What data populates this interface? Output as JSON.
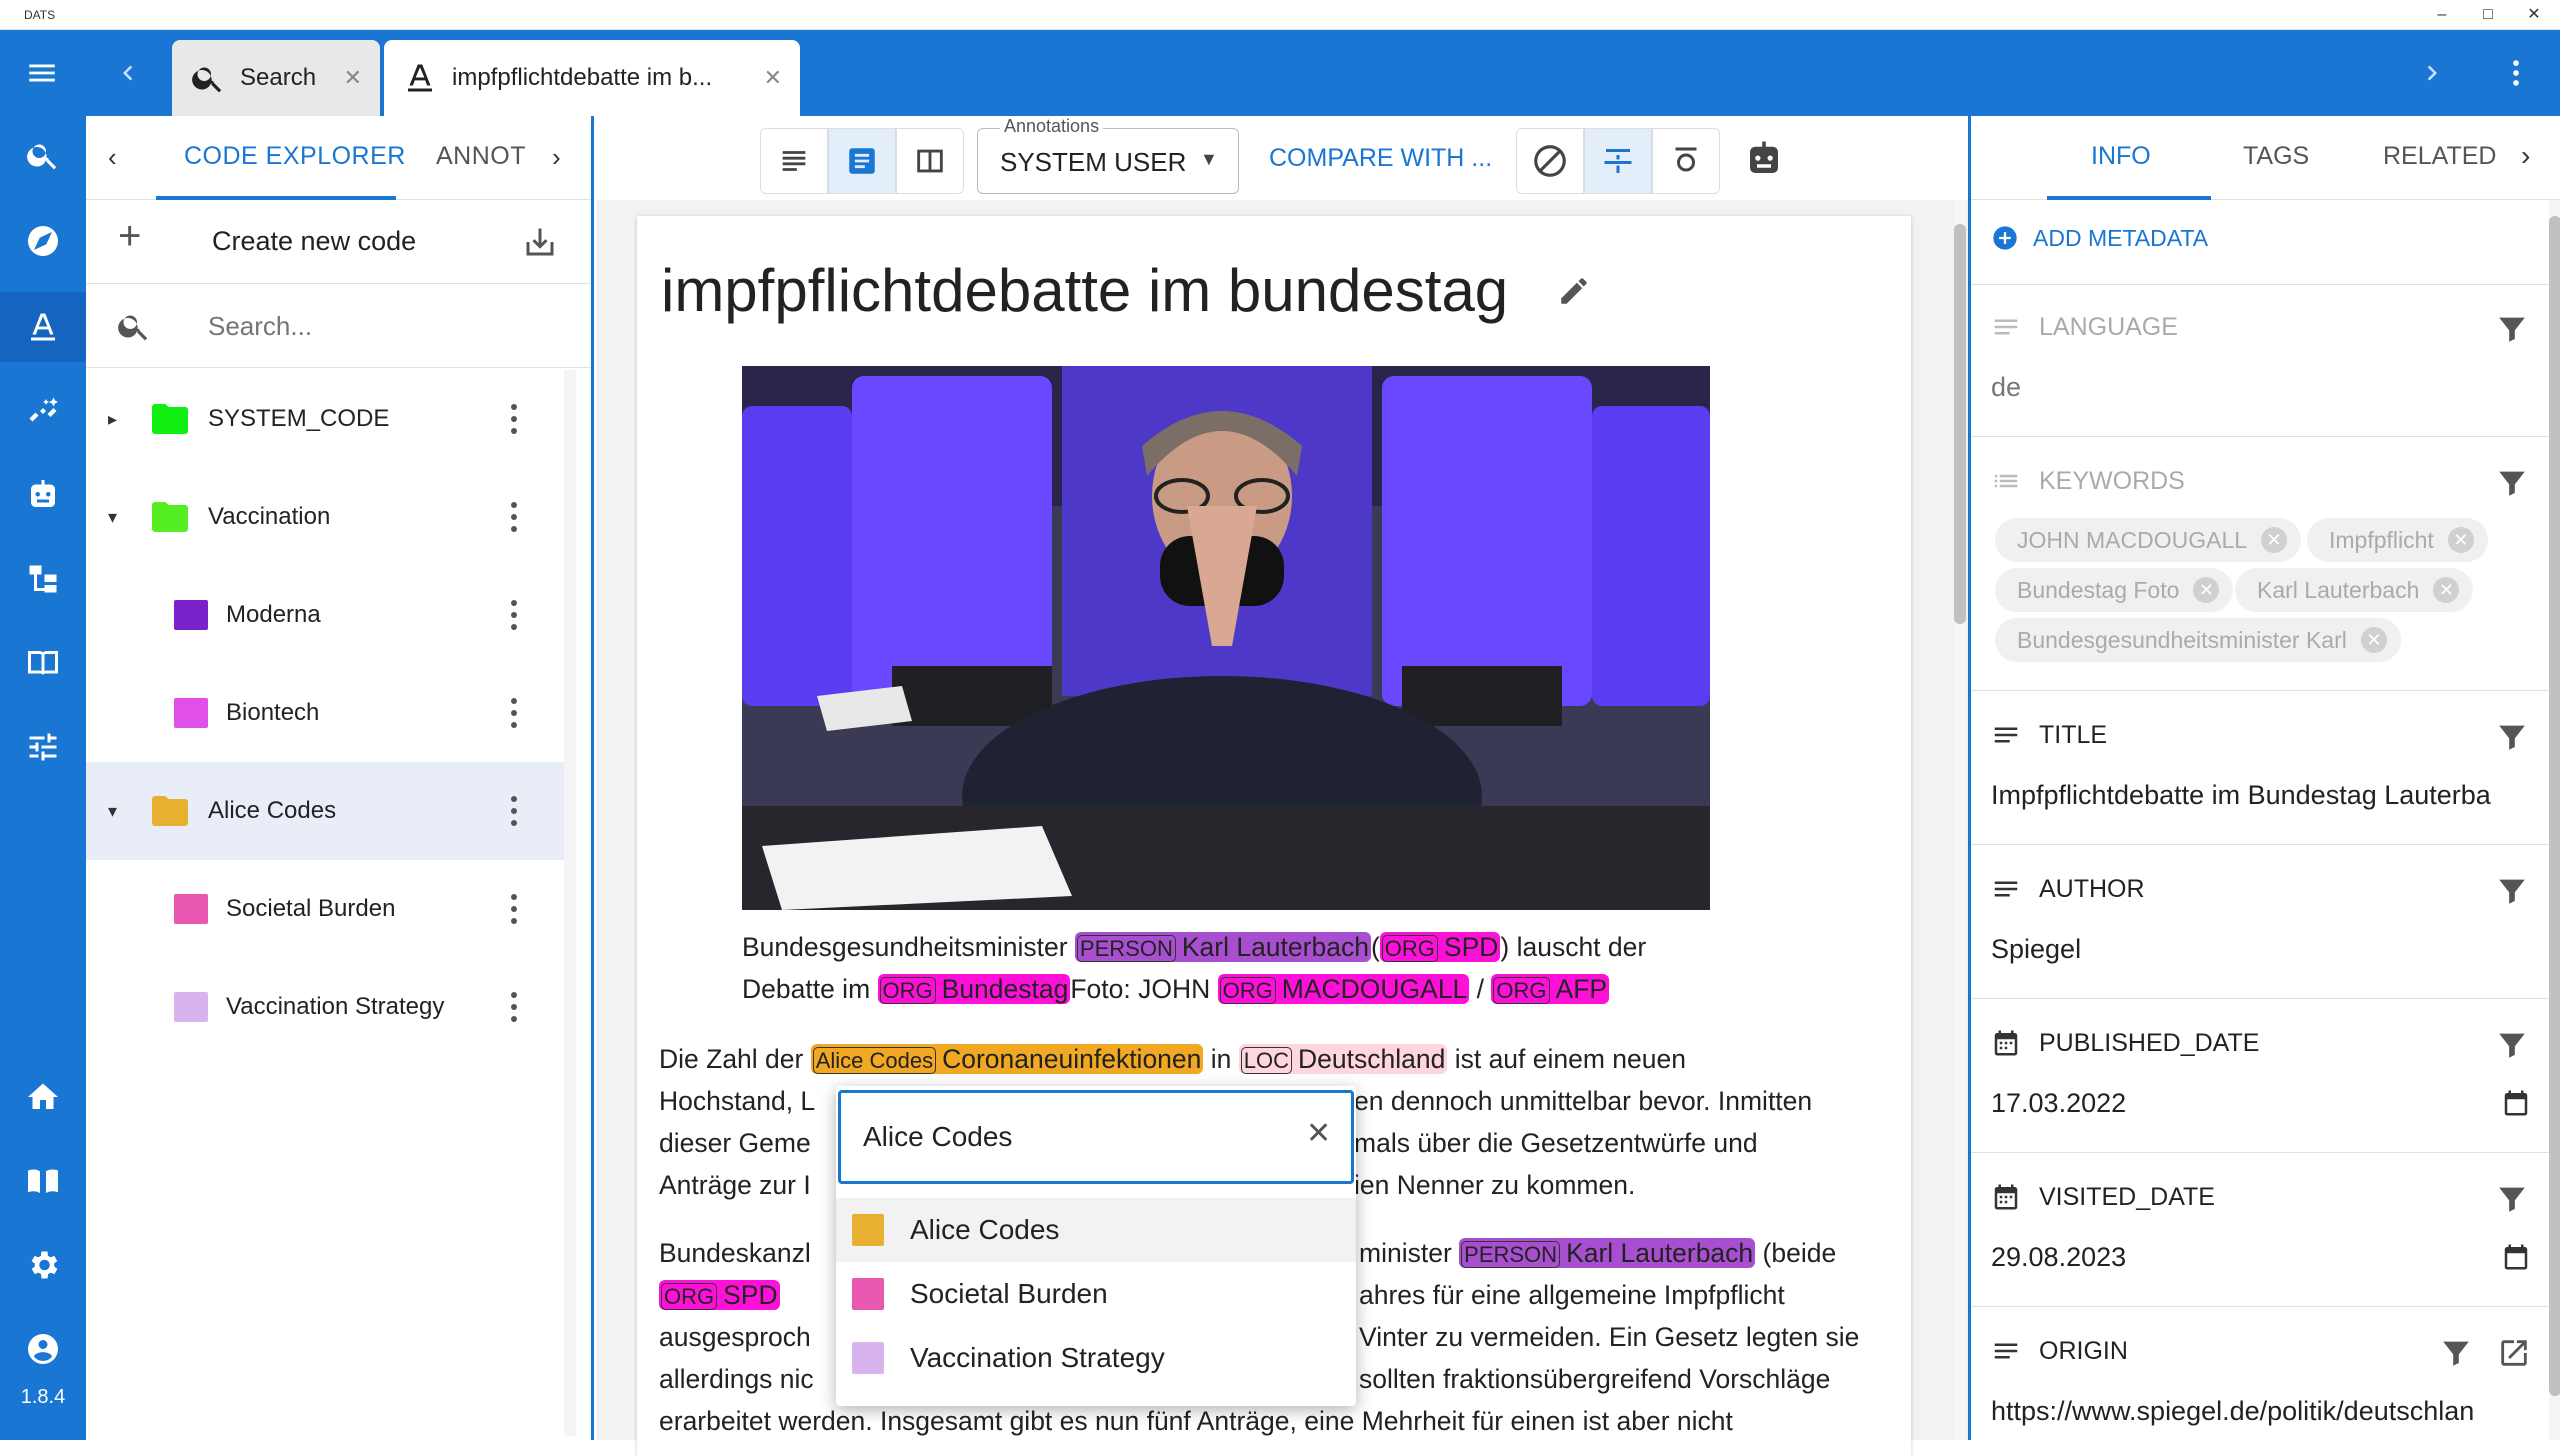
{
  "window": {
    "title": "DATS",
    "minimize": "–",
    "maximize": "□",
    "close": "✕"
  },
  "tabs": [
    {
      "label": "Search",
      "icon": "search-icon",
      "close": "✕"
    },
    {
      "label": "impfpflichtdebatte im b...",
      "icon": "annotation-icon",
      "close": "✕"
    }
  ],
  "colors": {
    "primary": "#1976d2",
    "system_code": "#11ee11",
    "vaccination": "#55ee22",
    "moderna": "#7a22cc",
    "biontech": "#e050e8",
    "alice_codes": "#e8b030",
    "societal_burden": "#e858b0",
    "vaccination_strategy": "#d8b4ee"
  },
  "sidebar": {
    "items": [
      "search-icon",
      "compass-icon",
      "annotation-icon",
      "magic-wand-icon",
      "robot-icon",
      "hierarchy-icon",
      "book-icon",
      "sliders-icon",
      "home-icon",
      "manual-icon",
      "settings-icon",
      "account-icon"
    ],
    "version": "1.8.4"
  },
  "left_panel": {
    "tabs": [
      "CODE EXPLORER",
      "ANNOT"
    ],
    "create_label": "Create new code",
    "search_placeholder": "Search...",
    "codes": [
      {
        "name": "SYSTEM_CODE",
        "type": "folder",
        "expander": "▸"
      },
      {
        "name": "Vaccination",
        "type": "folder",
        "expander": "▾"
      },
      {
        "name": "Moderna",
        "type": "code"
      },
      {
        "name": "Biontech",
        "type": "code"
      },
      {
        "name": "Alice Codes",
        "type": "folder",
        "expander": "▾",
        "selected": true
      },
      {
        "name": "Societal Burden",
        "type": "code"
      },
      {
        "name": "Vaccination Strategy",
        "type": "code"
      }
    ]
  },
  "toolbar": {
    "annotations_label": "Annotations",
    "user_select": "SYSTEM USER",
    "compare": "COMPARE WITH ..."
  },
  "document": {
    "title": "impfpflichtdebatte im bundestag",
    "caption": {
      "l1a": "Bundesgesundheitsminister ",
      "person_lbl": "PERSON",
      "person_txt": "Karl Lauterbach",
      "l1b": "(",
      "org_lbl": "ORG",
      "org1_txt": "SPD",
      "l1c": ") lauscht der",
      "l2a": "Debatte im ",
      "org2_txt": "Bundestag",
      "l2b": "Foto: JOHN ",
      "org3_txt": "MACDOUGALL",
      "l2c": " / ",
      "org4_txt": "AFP"
    },
    "p1": {
      "a": "Die Zahl der ",
      "alice_lbl": "Alice Codes",
      "alice_txt": "Coronaneuinfektionen",
      "b": " in ",
      "loc_lbl": "LOC",
      "loc_txt": "Deutschland",
      "c": " ist auf einem neuen",
      "l2a": "Hochstand, L",
      "l2b": "en dennoch unmittelbar bevor. Inmitten",
      "l3a": "dieser Geme",
      "l3b": "mals über die Gesetzentwürfe und",
      "l4a": "Anträge zur I",
      "l4b": "ien Nenner zu kommen."
    },
    "p2": {
      "l1a": "Bundeskanzl",
      "l1b": "minister ",
      "person_txt": "Karl Lauterbach",
      "l1c": " (beide",
      "org_txt": "SPD",
      "l2b": "ahres für eine allgemeine Impfpflicht",
      "l3a": "ausgesproch",
      "l3b": "Vinter zu vermeiden. Ein Gesetz legten sie",
      "l4a": "allerdings nic",
      "l4b": "sollten fraktionsübergreifend Vorschläge",
      "l5": "erarbeitet werden. Insgesamt gibt es nun fünf Anträge, eine Mehrheit für einen ist aber nicht"
    }
  },
  "popup": {
    "input_value": "Alice Codes",
    "close": "✕",
    "options": [
      "Alice Codes",
      "Societal Burden",
      "Vaccination Strategy"
    ]
  },
  "right_panel": {
    "tabs": [
      "INFO",
      "TAGS",
      "RELATED"
    ],
    "add_metadata": "ADD METADATA",
    "fields": {
      "language": {
        "label": "LANGUAGE",
        "value": "de"
      },
      "keywords": {
        "label": "KEYWORDS",
        "chips": [
          "JOHN MACDOUGALL",
          "Impfpflicht",
          "Bundestag Foto",
          "Karl Lauterbach",
          "Bundesgesundheitsminister Karl"
        ]
      },
      "title": {
        "label": "TITLE",
        "value": "Impfpflichtdebatte im Bundestag Lauterba"
      },
      "author": {
        "label": "AUTHOR",
        "value": "Spiegel"
      },
      "published": {
        "label": "PUBLISHED_DATE",
        "value": "17.03.2022"
      },
      "visited": {
        "label": "VISITED_DATE",
        "value": "29.08.2023"
      },
      "origin": {
        "label": "ORIGIN",
        "value": "https://www.spiegel.de/politik/deutschlan"
      }
    }
  }
}
